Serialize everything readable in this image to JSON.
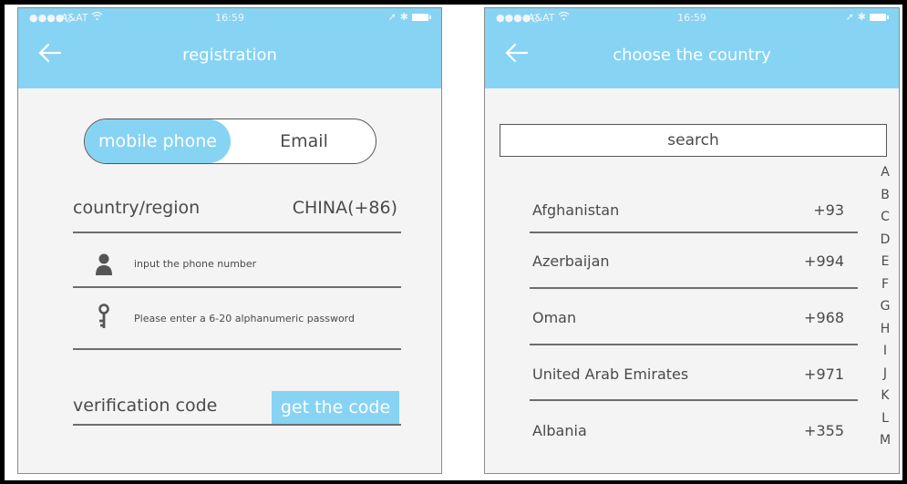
{
  "status_bar": {
    "signal": "●●●●○",
    "carrier": "A&AT",
    "time": "16:59"
  },
  "registration": {
    "title": "registration",
    "tabs": [
      {
        "label": "mobile phone",
        "active": true
      },
      {
        "label": "Email",
        "active": false
      }
    ],
    "country_label": "country/region",
    "country_value": "CHINA(+86)",
    "phone_placeholder": "input the phone number",
    "password_placeholder": "Please enter a 6-20 alphanumeric password",
    "verification_label": "verification code",
    "get_code_label": "get the code"
  },
  "choose_country": {
    "title": "choose the country",
    "search_placeholder": "search",
    "countries": [
      {
        "name": "Afghanistan",
        "code": "+93"
      },
      {
        "name": "Azerbaijan",
        "code": "+994"
      },
      {
        "name": "Oman",
        "code": "+968"
      },
      {
        "name": "United Arab Emirates",
        "code": "+971"
      },
      {
        "name": "Albania",
        "code": "+355"
      }
    ],
    "index_letters": [
      "A",
      "B",
      "C",
      "D",
      "E",
      "F",
      "G",
      "H",
      "I",
      "J",
      "K",
      "L",
      "M"
    ]
  },
  "colors": {
    "accent": "#87d3f4",
    "background": "#f4f4f4",
    "text": "#4a4a4a"
  }
}
